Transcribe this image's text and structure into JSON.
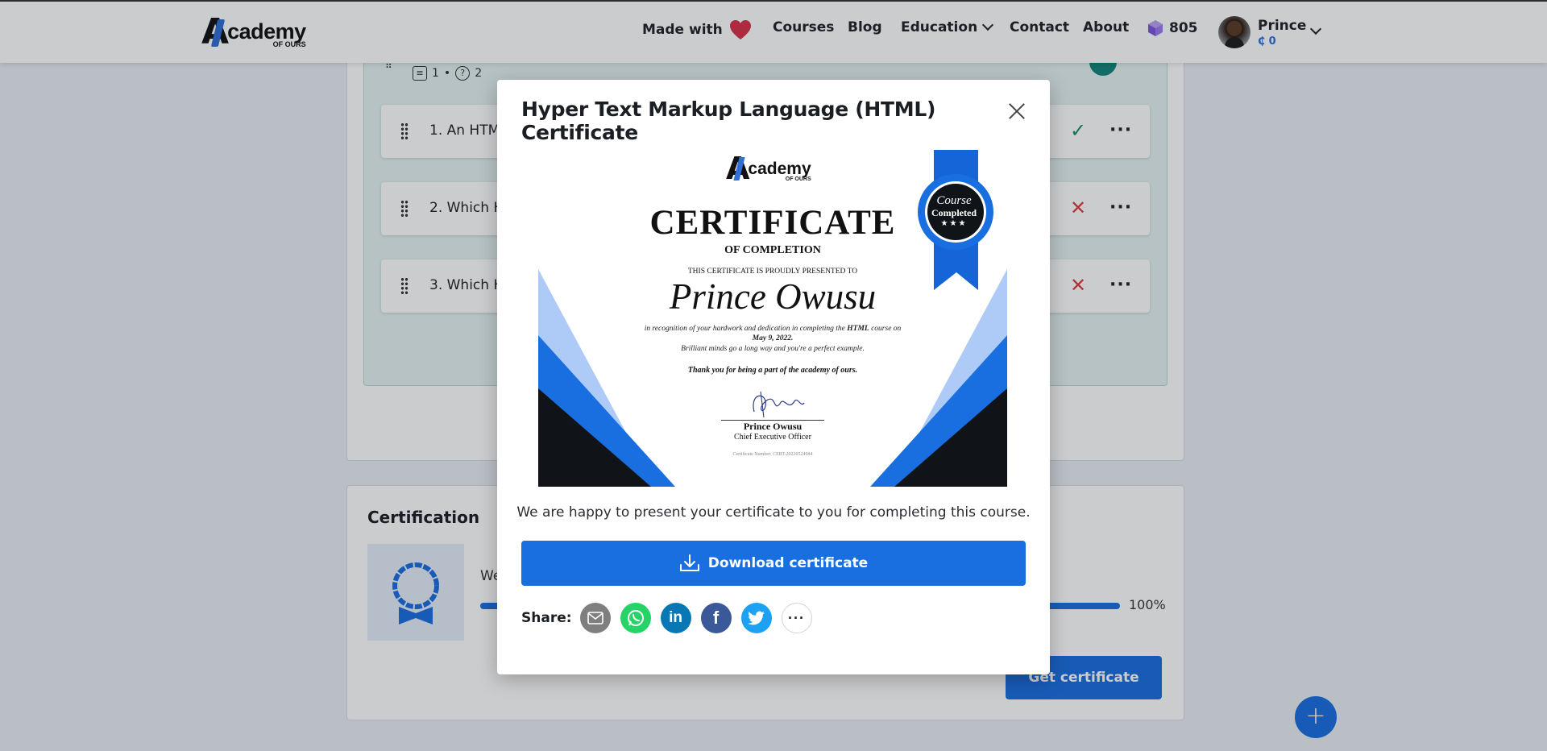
{
  "header": {
    "logo_main": "cademy",
    "logo_sub": "OF OURS",
    "logo_letter": "A",
    "made_with": "Made with",
    "nav": [
      "Courses",
      "Blog",
      "Education",
      "Contact",
      "About"
    ],
    "gems": "805",
    "user_name": "Prince",
    "user_coins": "₵ 0"
  },
  "section": {
    "lessons_count": "1",
    "quiz_count": "2",
    "questions": [
      {
        "text": "1. An HTML",
        "status": "correct"
      },
      {
        "text": "2. Which H",
        "status": "wrong"
      },
      {
        "text": "3. Which H",
        "status": "wrong"
      }
    ]
  },
  "certification": {
    "title": "Certification",
    "message": "We",
    "progress": 100,
    "progress_label": "100%",
    "button": "Get certificate"
  },
  "modal": {
    "title": "Hyper Text Markup Language (HTML) Certificate",
    "message": "We are happy to present your certificate to you for completing this course.",
    "download_label": "Download certificate",
    "share_label": "Share:",
    "share_icons": [
      "email-icon",
      "whatsapp-icon",
      "linkedin-icon",
      "facebook-icon",
      "twitter-icon",
      "more-icon"
    ]
  },
  "certificate": {
    "logo_main": "cademy",
    "logo_sub": "OF OURS",
    "heading": "CERTIFICATE",
    "sub_heading": "OF COMPLETION",
    "presented": "THIS CERTIFICATE IS PROUDLY PRESENTED TO",
    "recipient": "Prince Owusu",
    "body_prefix": "in recognition of your hardwork and dedication in completing the ",
    "course": "HTML",
    "body_suffix": " course on",
    "date": "May 9, 2022.",
    "line3": "Brilliant minds go a long way and you're a perfect example.",
    "thanks": "Thank you for being a part of the academy of ours.",
    "signer_name": "Prince Owusu",
    "signer_title": "Chief Executive Officer",
    "number": "Certificate Number: CERT-20220524984",
    "badge_line1": "Course",
    "badge_line2": "Completed",
    "badge_stars": "★★★"
  },
  "colors": {
    "accent": "#1a6fe0",
    "success": "#1a8a72",
    "error": "#e0383a",
    "ribbon": "#1565d8"
  }
}
